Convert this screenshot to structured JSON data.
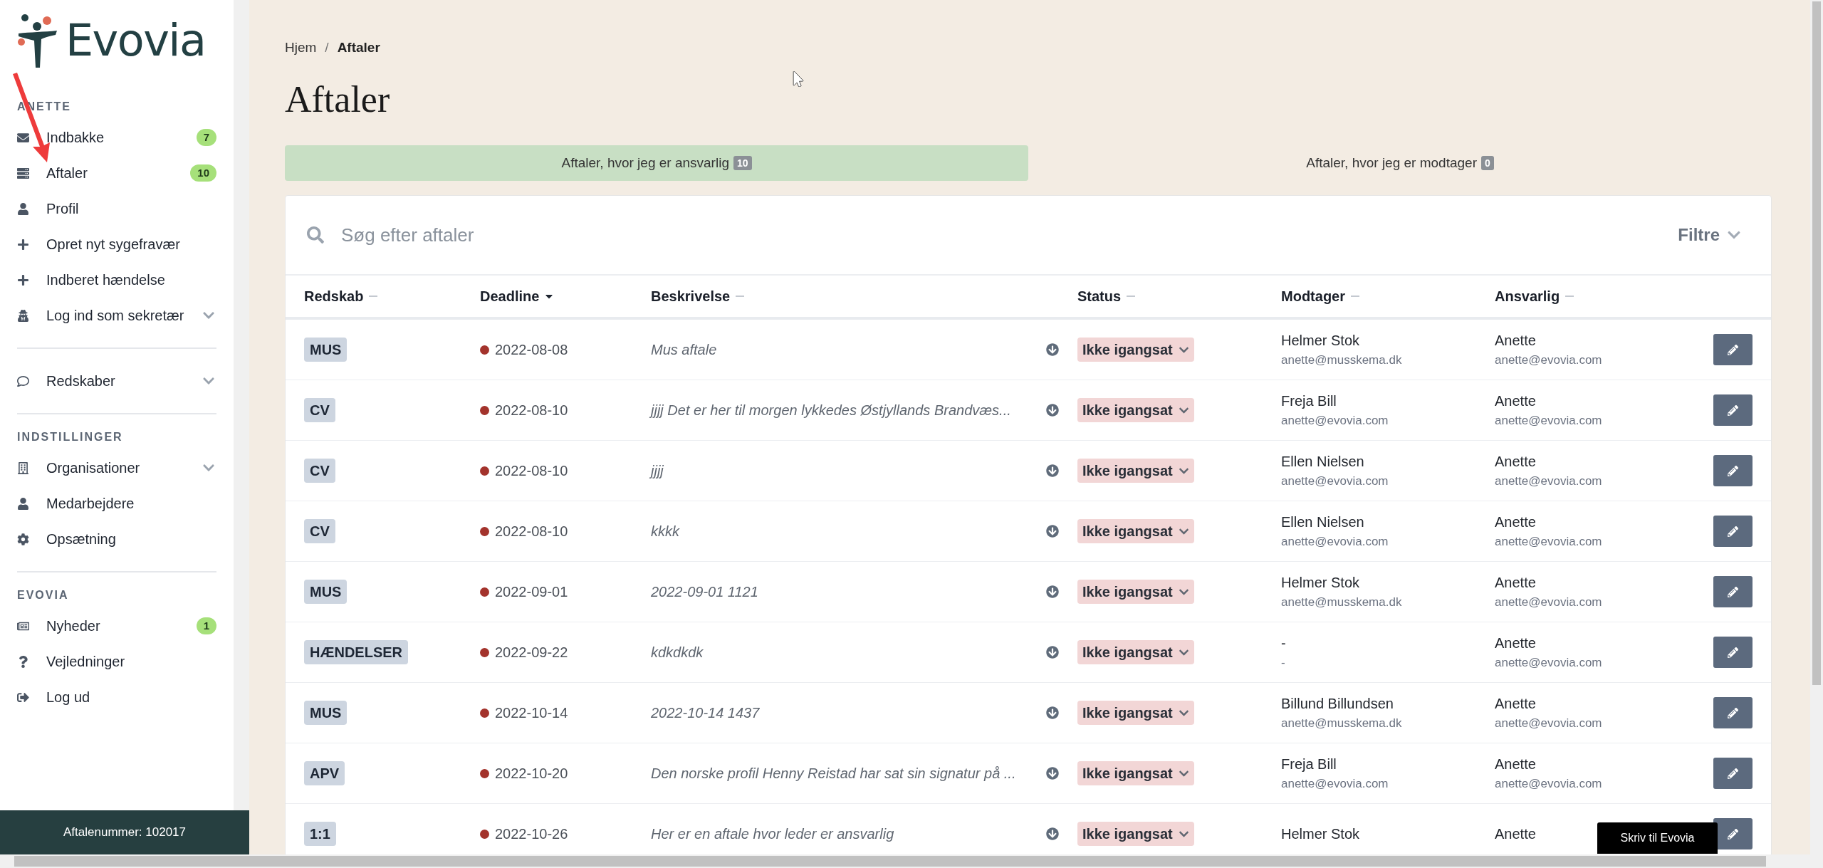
{
  "logo": {
    "text": "Evovia"
  },
  "sidebar": {
    "sections": [
      {
        "label": "ANETTE",
        "items": [
          {
            "label": "Indbakke",
            "badge": "7",
            "expandable": false
          },
          {
            "label": "Aftaler",
            "badge": "10",
            "expandable": false
          },
          {
            "label": "Profil",
            "expandable": false
          },
          {
            "label": "Opret nyt sygefravær",
            "expandable": false
          },
          {
            "label": "Indberet hændelse",
            "expandable": false
          },
          {
            "label": "Log ind som sekretær",
            "expandable": true
          }
        ]
      },
      {
        "items": [
          {
            "label": "Redskaber",
            "expandable": true
          }
        ]
      },
      {
        "label": "INDSTILLINGER",
        "items": [
          {
            "label": "Organisationer",
            "expandable": true
          },
          {
            "label": "Medarbejdere",
            "expandable": false
          },
          {
            "label": "Opsætning",
            "expandable": false
          }
        ]
      },
      {
        "label": "EVOVIA",
        "items": [
          {
            "label": "Nyheder",
            "badge": "1",
            "expandable": false
          },
          {
            "label": "Vejledninger",
            "expandable": false
          },
          {
            "label": "Log ud",
            "expandable": false
          }
        ]
      }
    ],
    "footer": "Aftalenummer: 102017"
  },
  "breadcrumb": [
    "Hjem",
    "Aftaler"
  ],
  "breadcrumb_separator": "/",
  "page_title": "Aftaler",
  "tabs": [
    {
      "label": "Aftaler, hvor jeg er ansvarlig",
      "count": "10",
      "selected": true
    },
    {
      "label": "Aftaler, hvor jeg er modtager",
      "count": "0",
      "selected": false
    }
  ],
  "search": {
    "placeholder": "Søg efter aftaler"
  },
  "filter_button": "Filtre",
  "table": {
    "columns": [
      {
        "label": "Redskab",
        "sorted": false
      },
      {
        "label": "Deadline",
        "sorted": true
      },
      {
        "label": "Beskrivelse",
        "sorted": false
      },
      {
        "label": "Status",
        "sorted": false
      },
      {
        "label": "Modtager",
        "sorted": false
      },
      {
        "label": "Ansvarlig",
        "sorted": false
      }
    ],
    "rows": [
      {
        "redskab": "MUS",
        "deadline": "2022-08-08",
        "beskrivelse": "Mus aftale",
        "status": "Ikke igangsat",
        "modtager": "Helmer Stok",
        "modtager_email": "anette@musskema.dk",
        "ansvarlig": "Anette",
        "ansvarlig_email": "anette@evovia.com"
      },
      {
        "redskab": "CV",
        "deadline": "2022-08-10",
        "beskrivelse": "jjjj Det er her til morgen lykkedes Østjyllands Brandvæs...",
        "status": "Ikke igangsat",
        "modtager": "Freja Bill",
        "modtager_email": "anette@evovia.com",
        "ansvarlig": "Anette",
        "ansvarlig_email": "anette@evovia.com"
      },
      {
        "redskab": "CV",
        "deadline": "2022-08-10",
        "beskrivelse": "jjjj",
        "status": "Ikke igangsat",
        "modtager": "Ellen Nielsen",
        "modtager_email": "anette@evovia.com",
        "ansvarlig": "Anette",
        "ansvarlig_email": "anette@evovia.com"
      },
      {
        "redskab": "CV",
        "deadline": "2022-08-10",
        "beskrivelse": "kkkk",
        "status": "Ikke igangsat",
        "modtager": "Ellen Nielsen",
        "modtager_email": "anette@evovia.com",
        "ansvarlig": "Anette",
        "ansvarlig_email": "anette@evovia.com"
      },
      {
        "redskab": "MUS",
        "deadline": "2022-09-01",
        "beskrivelse": "2022-09-01 1121",
        "status": "Ikke igangsat",
        "modtager": "Helmer Stok",
        "modtager_email": "anette@musskema.dk",
        "ansvarlig": "Anette",
        "ansvarlig_email": "anette@evovia.com"
      },
      {
        "redskab": "HÆNDELSER",
        "deadline": "2022-09-22",
        "beskrivelse": "kdkdkdk",
        "status": "Ikke igangsat",
        "modtager": "-",
        "modtager_email": "-",
        "ansvarlig": "Anette",
        "ansvarlig_email": "anette@evovia.com"
      },
      {
        "redskab": "MUS",
        "deadline": "2022-10-14",
        "beskrivelse": "2022-10-14 1437",
        "status": "Ikke igangsat",
        "modtager": "Billund Billundsen",
        "modtager_email": "anette@musskema.dk",
        "ansvarlig": "Anette",
        "ansvarlig_email": "anette@evovia.com"
      },
      {
        "redskab": "APV",
        "deadline": "2022-10-20",
        "beskrivelse": "Den norske profil Henny Reistad har sat sin signatur på ...",
        "status": "Ikke igangsat",
        "modtager": "Freja Bill",
        "modtager_email": "anette@evovia.com",
        "ansvarlig": "Anette",
        "ansvarlig_email": "anette@evovia.com"
      },
      {
        "redskab": "1:1",
        "deadline": "2022-10-26",
        "beskrivelse": "Her er en aftale hvor leder er ansvarlig",
        "status": "Ikke igangsat",
        "modtager": "Helmer Stok",
        "ansvarlig": "Anette"
      }
    ]
  },
  "chat_button": "Skriv til Evovia"
}
